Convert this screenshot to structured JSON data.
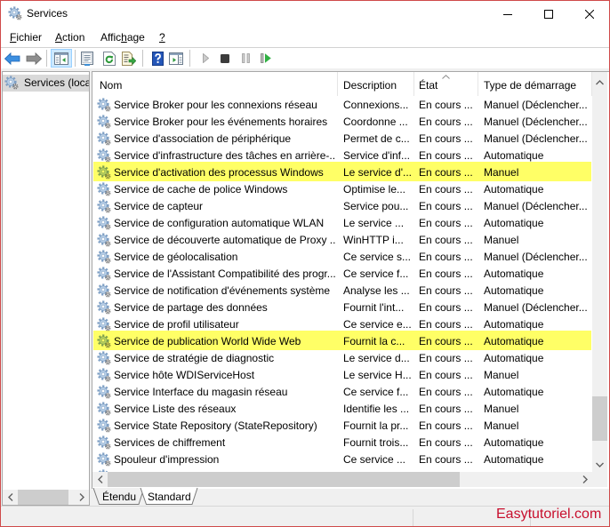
{
  "window": {
    "title": "Services",
    "app_icon": "services-gear-icon",
    "controls": [
      {
        "id": "minimize",
        "icon": "minimize-icon"
      },
      {
        "id": "maximize",
        "icon": "maximize-icon"
      },
      {
        "id": "close",
        "icon": "close-icon"
      }
    ]
  },
  "menu": [
    {
      "label": "Fichier",
      "pre": "",
      "key": "F",
      "post": "ichier"
    },
    {
      "label": "Action",
      "pre": "",
      "key": "A",
      "post": "ction"
    },
    {
      "label": "Affichage",
      "pre": "Affic",
      "key": "h",
      "post": "age"
    },
    {
      "label": "?",
      "pre": "",
      "key": "?",
      "post": ""
    }
  ],
  "toolbar": [
    {
      "id": "back",
      "icon": "back-arrow-icon",
      "enabled": true
    },
    {
      "id": "forward",
      "icon": "forward-arrow-icon",
      "enabled": true
    },
    {
      "id": "show-hide-console-tree",
      "icon": "console-tree-icon",
      "enabled": true,
      "pressed": true
    },
    {
      "id": "properties",
      "icon": "properties-icon",
      "enabled": true
    },
    {
      "id": "refresh",
      "icon": "refresh-icon",
      "enabled": true
    },
    {
      "id": "export-list",
      "icon": "export-list-icon",
      "enabled": true
    },
    {
      "id": "help",
      "icon": "help-icon",
      "enabled": true
    },
    {
      "id": "show-hide-action-pane",
      "icon": "action-pane-icon",
      "enabled": true
    },
    {
      "id": "start-service",
      "icon": "play-icon",
      "enabled": false
    },
    {
      "id": "stop-service",
      "icon": "stop-icon",
      "enabled": true
    },
    {
      "id": "pause-service",
      "icon": "pause-icon",
      "enabled": false
    },
    {
      "id": "restart-service",
      "icon": "resume-icon",
      "enabled": true
    }
  ],
  "tree": {
    "items": [
      {
        "label": "Services (loca",
        "icon": "services-gear-icon",
        "selected": true
      }
    ]
  },
  "table": {
    "columns": [
      {
        "label": "Nom"
      },
      {
        "label": "Description"
      },
      {
        "label": "État",
        "sort": "ascending"
      },
      {
        "label": "Type de démarrage"
      }
    ],
    "row_icon": "service-gear-icon",
    "rows": [
      {
        "name": "Service Broker pour les connexions réseau",
        "description": "Connexions...",
        "state": "En cours ...",
        "startup": "Manuel (Déclencher...",
        "highlighted": false
      },
      {
        "name": "Service Broker pour les événements horaires",
        "description": "Coordonne ...",
        "state": "En cours ...",
        "startup": "Manuel (Déclencher...",
        "highlighted": false
      },
      {
        "name": "Service d'association de périphérique",
        "description": "Permet de c...",
        "state": "En cours ...",
        "startup": "Manuel (Déclencher...",
        "highlighted": false
      },
      {
        "name": "Service d'infrastructure des tâches en arrière-...",
        "description": "Service d'inf...",
        "state": "En cours ...",
        "startup": "Automatique",
        "highlighted": false
      },
      {
        "name": "Service d'activation des processus Windows",
        "description": "Le service d'...",
        "state": "En cours ...",
        "startup": "Manuel",
        "highlighted": true
      },
      {
        "name": "Service de cache de police Windows",
        "description": "Optimise le...",
        "state": "En cours ...",
        "startup": "Automatique",
        "highlighted": false
      },
      {
        "name": "Service de capteur",
        "description": "Service pou...",
        "state": "En cours ...",
        "startup": "Manuel (Déclencher...",
        "highlighted": false
      },
      {
        "name": "Service de configuration automatique WLAN",
        "description": "Le service ...",
        "state": "En cours ...",
        "startup": "Automatique",
        "highlighted": false
      },
      {
        "name": "Service de découverte automatique de Proxy ...",
        "description": "WinHTTP i...",
        "state": "En cours ...",
        "startup": "Manuel",
        "highlighted": false
      },
      {
        "name": "Service de géolocalisation",
        "description": "Ce service s...",
        "state": "En cours ...",
        "startup": "Manuel (Déclencher...",
        "highlighted": false
      },
      {
        "name": "Service de l'Assistant Compatibilité des progr...",
        "description": "Ce service f...",
        "state": "En cours ...",
        "startup": "Automatique",
        "highlighted": false
      },
      {
        "name": "Service de notification d'événements système",
        "description": "Analyse les ...",
        "state": "En cours ...",
        "startup": "Automatique",
        "highlighted": false
      },
      {
        "name": "Service de partage des données",
        "description": "Fournit l'int...",
        "state": "En cours ...",
        "startup": "Manuel (Déclencher...",
        "highlighted": false
      },
      {
        "name": "Service de profil utilisateur",
        "description": "Ce service e...",
        "state": "En cours ...",
        "startup": "Automatique",
        "highlighted": false
      },
      {
        "name": "Service de publication World Wide Web",
        "description": "Fournit la c...",
        "state": "En cours ...",
        "startup": "Automatique",
        "highlighted": true
      },
      {
        "name": "Service de stratégie de diagnostic",
        "description": "Le service d...",
        "state": "En cours ...",
        "startup": "Automatique",
        "highlighted": false
      },
      {
        "name": "Service hôte WDIServiceHost",
        "description": "Le service H...",
        "state": "En cours ...",
        "startup": "Manuel",
        "highlighted": false
      },
      {
        "name": "Service Interface du magasin réseau",
        "description": "Ce service f...",
        "state": "En cours ...",
        "startup": "Automatique",
        "highlighted": false
      },
      {
        "name": "Service Liste des réseaux",
        "description": "Identifie les ...",
        "state": "En cours ...",
        "startup": "Manuel",
        "highlighted": false
      },
      {
        "name": "Service State Repository (StateRepository)",
        "description": "Fournit la pr...",
        "state": "En cours ...",
        "startup": "Manuel",
        "highlighted": false
      },
      {
        "name": "Services de chiffrement",
        "description": "Fournit trois...",
        "state": "En cours ...",
        "startup": "Automatique",
        "highlighted": false
      },
      {
        "name": "Spouleur d'impression",
        "description": "Ce service ...",
        "state": "En cours ...",
        "startup": "Automatique",
        "highlighted": false
      }
    ]
  },
  "scrollbars": {
    "list_vertical": {
      "position": 0.95,
      "visible_fraction": 0.12
    },
    "list_horizontal": {
      "position": 0,
      "visible_fraction": 0.75
    },
    "tree_horizontal": {
      "position": 0,
      "visible_fraction": 0.9
    }
  },
  "tabs": [
    {
      "label": "Étendu",
      "active": false
    },
    {
      "label": "Standard",
      "active": true
    }
  ],
  "watermark": "Easytutoriel.com",
  "colors": {
    "window_border": "#cf4a4a",
    "row_highlight": "#ffff66",
    "watermark": "#c8102e",
    "tree_selection": "#d9d9d9",
    "toolbar_pressed": "#cce8ff"
  }
}
